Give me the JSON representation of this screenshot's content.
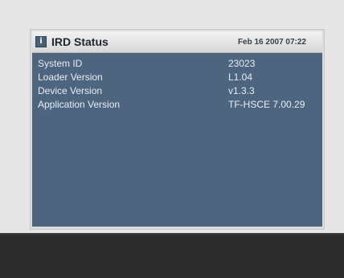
{
  "panel": {
    "icon": "info-icon",
    "icon_glyph": "i",
    "title": "IRD Status",
    "datetime": "Feb 16 2007 07:22"
  },
  "rows": [
    {
      "label": "System ID",
      "value": "23023"
    },
    {
      "label": "Loader Version",
      "value": "L1.04"
    },
    {
      "label": "Device Version",
      "value": "v1.3.3"
    },
    {
      "label": "Application Version",
      "value": "TF-HSCE 7.00.29"
    }
  ],
  "colors": {
    "content_background": "#4e6580",
    "header_background": "#e6e6e6",
    "text": "#e8edf2",
    "bottom_bar": "#2b2b2b"
  }
}
